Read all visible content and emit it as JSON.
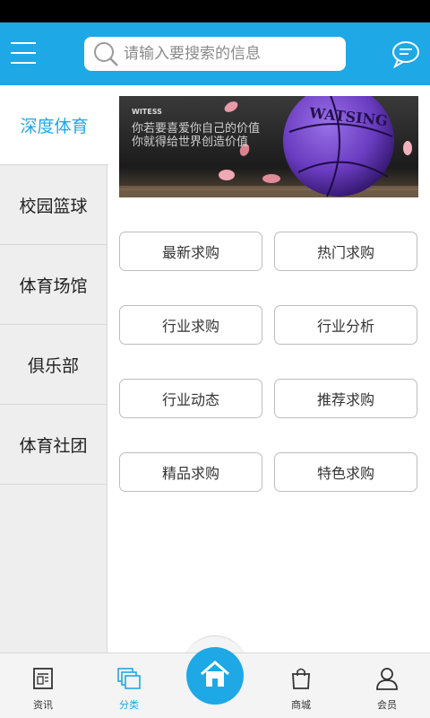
{
  "header": {
    "search_placeholder": "请输入要搜索的信息"
  },
  "sidebar": {
    "items": [
      {
        "label": "深度体育",
        "active": true
      },
      {
        "label": "校园篮球",
        "active": false
      },
      {
        "label": "体育场馆",
        "active": false
      },
      {
        "label": "俱乐部",
        "active": false
      },
      {
        "label": "体育社团",
        "active": false
      }
    ]
  },
  "banner": {
    "brand": "WITESS",
    "line1": "你若要喜爱你自己的价值",
    "line2": "你就得给世界创造价值",
    "ball_text": "WATSING"
  },
  "grid": {
    "buttons": [
      "最新求购",
      "热门求购",
      "行业求购",
      "行业分析",
      "行业动态",
      "推荐求购",
      "精品求购",
      "特色求购"
    ]
  },
  "tabbar": {
    "tabs": [
      {
        "label": "资讯",
        "icon": "news-icon",
        "active": false
      },
      {
        "label": "分类",
        "icon": "category-icon",
        "active": true
      },
      {
        "label": "",
        "icon": "home-icon",
        "active": false
      },
      {
        "label": "商城",
        "icon": "shop-bag-icon",
        "active": false
      },
      {
        "label": "会员",
        "icon": "member-icon",
        "active": false
      }
    ]
  },
  "colors": {
    "accent": "#1ea8e6",
    "ball": "#6a3cc0"
  }
}
